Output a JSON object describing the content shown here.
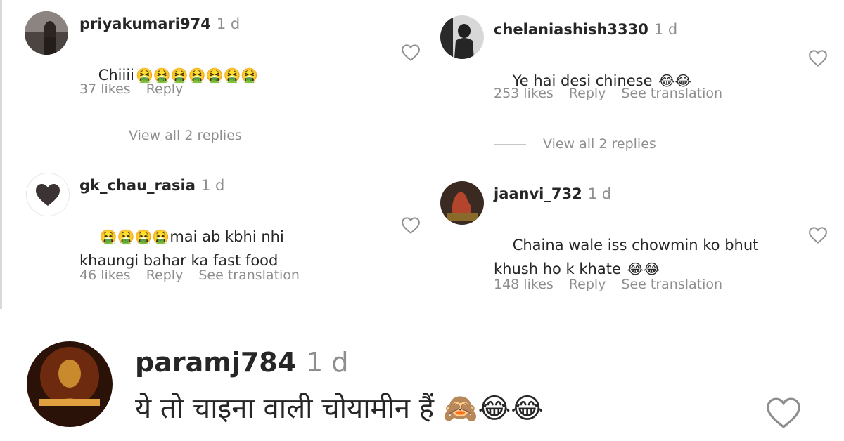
{
  "comments": [
    {
      "username": "priyakumari974",
      "time": "1 d",
      "text": "Chiiii",
      "emojis": "🤮🤮🤮🤮🤮🤮🤮",
      "likes": "37 likes",
      "reply": "Reply",
      "see_translation": "",
      "view_replies": "View all 2 replies"
    },
    {
      "username": "chelaniashish3330",
      "time": "1 d",
      "text": "Ye hai desi chinese ",
      "emojis": "😂😂",
      "likes": "253 likes",
      "reply": "Reply",
      "see_translation": "See translation",
      "view_replies": "View all 2 replies"
    },
    {
      "username": "gk_chau_rasia",
      "time": "1 d",
      "text_prefix_emojis": "🤮🤮🤮🤮",
      "text": "mai ab kbhi nhi\nkhaungi bahar ka fast food",
      "likes": "46 likes",
      "reply": "Reply",
      "see_translation": "See translation"
    },
    {
      "username": "jaanvi_732",
      "time": "1 d",
      "text": "Chaina wale iss chowmin ko bhut\nkhush ho k khate ",
      "emojis": "😂😂",
      "likes": "148 likes",
      "reply": "Reply",
      "see_translation": "See translation"
    }
  ],
  "featured": {
    "username": "paramj784",
    "time": "1 d",
    "text": "ये तो चाइना वाली चोयामीन हैं ",
    "emojis": "🙈😂😂"
  },
  "icons": {
    "heart": "heart-outline-icon",
    "accent_text": "#262626",
    "muted_text": "#8e8e8e"
  }
}
